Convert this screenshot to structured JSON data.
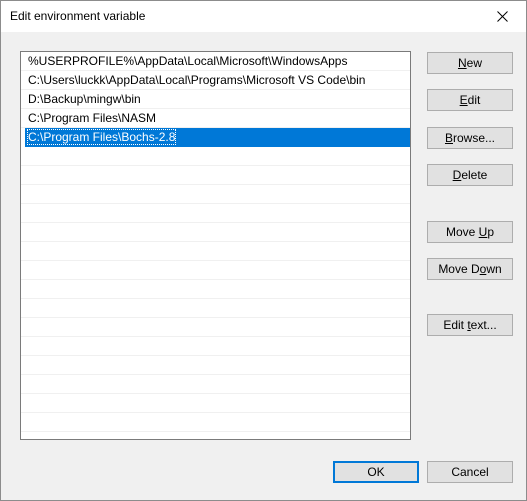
{
  "window": {
    "title": "Edit environment variable"
  },
  "list": {
    "items": [
      "%USERPROFILE%\\AppData\\Local\\Microsoft\\WindowsApps",
      "C:\\Users\\luckk\\AppData\\Local\\Programs\\Microsoft VS Code\\bin",
      "D:\\Backup\\mingw\\bin",
      "C:\\Program Files\\NASM",
      "C:\\Program Files\\Bochs-2.8"
    ],
    "selected_index": 4
  },
  "buttons": {
    "new": {
      "before": "",
      "key": "N",
      "after": "ew"
    },
    "edit": {
      "before": "",
      "key": "E",
      "after": "dit"
    },
    "browse": {
      "before": "",
      "key": "B",
      "after": "rowse..."
    },
    "delete": {
      "before": "",
      "key": "D",
      "after": "elete"
    },
    "move_up": {
      "before": "Move ",
      "key": "U",
      "after": "p"
    },
    "move_down": {
      "before": "Move D",
      "key": "o",
      "after": "wn"
    },
    "edit_text": {
      "before": "Edit ",
      "key": "t",
      "after": "ext..."
    },
    "ok": "OK",
    "cancel": "Cancel"
  },
  "colors": {
    "selection": "#0078d7",
    "dialog_background": "#f0f0f0"
  }
}
